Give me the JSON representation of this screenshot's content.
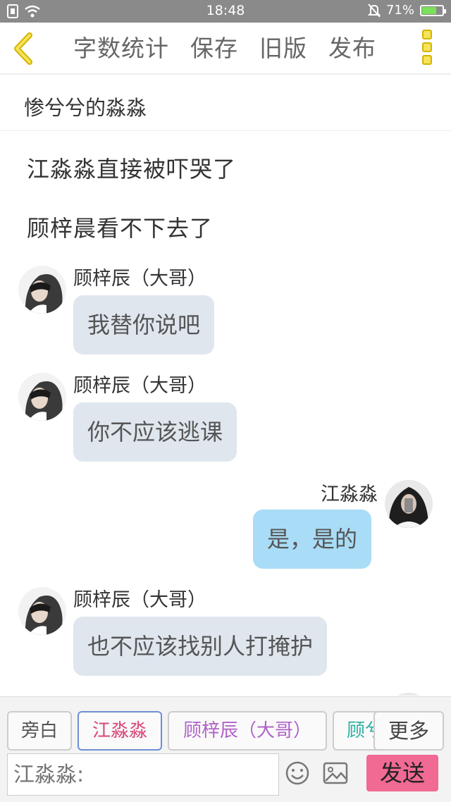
{
  "status_bar": {
    "time": "18:48",
    "battery_percent": "71%",
    "battery_level": 0.71,
    "icons": [
      "sim-icon",
      "wifi-icon",
      "silent-bell-icon",
      "battery-icon"
    ]
  },
  "toolbar": {
    "back_icon": "chevron-left-icon",
    "actions": [
      {
        "label": "字数统计"
      },
      {
        "label": "保存"
      },
      {
        "label": "旧版"
      },
      {
        "label": "发布"
      }
    ],
    "more_icon": "vertical-dots-icon"
  },
  "chapter": {
    "title": "惨兮兮的淼淼"
  },
  "messages": {
    "narration1": "江淼淼直接被吓哭了",
    "narration2": "顾梓晨看不下去了",
    "m1": {
      "speaker": "顾梓辰（大哥）",
      "text": "我替你说吧"
    },
    "m2": {
      "speaker": "顾梓辰（大哥）",
      "text": "你不应该逃课"
    },
    "m3": {
      "speaker": "江淼淼",
      "text": "是，是的"
    },
    "m4": {
      "speaker": "顾梓辰（大哥）",
      "text": "也不应该找别人打掩护"
    }
  },
  "roles": {
    "items": [
      {
        "label": "旁白",
        "color": "#555555"
      },
      {
        "label": "江淼淼",
        "color": "#d9477a"
      },
      {
        "label": "顾梓辰（大哥）",
        "color": "#b063c9"
      },
      {
        "label": "顾兮",
        "color": "#2ab0a0"
      }
    ],
    "selected": "江淼淼",
    "more_label": "更多"
  },
  "composer": {
    "placeholder": "江淼淼:",
    "send_label": "发送",
    "emoji_icon": "smiley-icon",
    "image_icon": "image-icon"
  },
  "colors": {
    "accent_yellow": "#f5e35a",
    "left_bubble": "#dfe6ee",
    "right_bubble": "#a9dcf6",
    "send_button": "#f06a93"
  }
}
